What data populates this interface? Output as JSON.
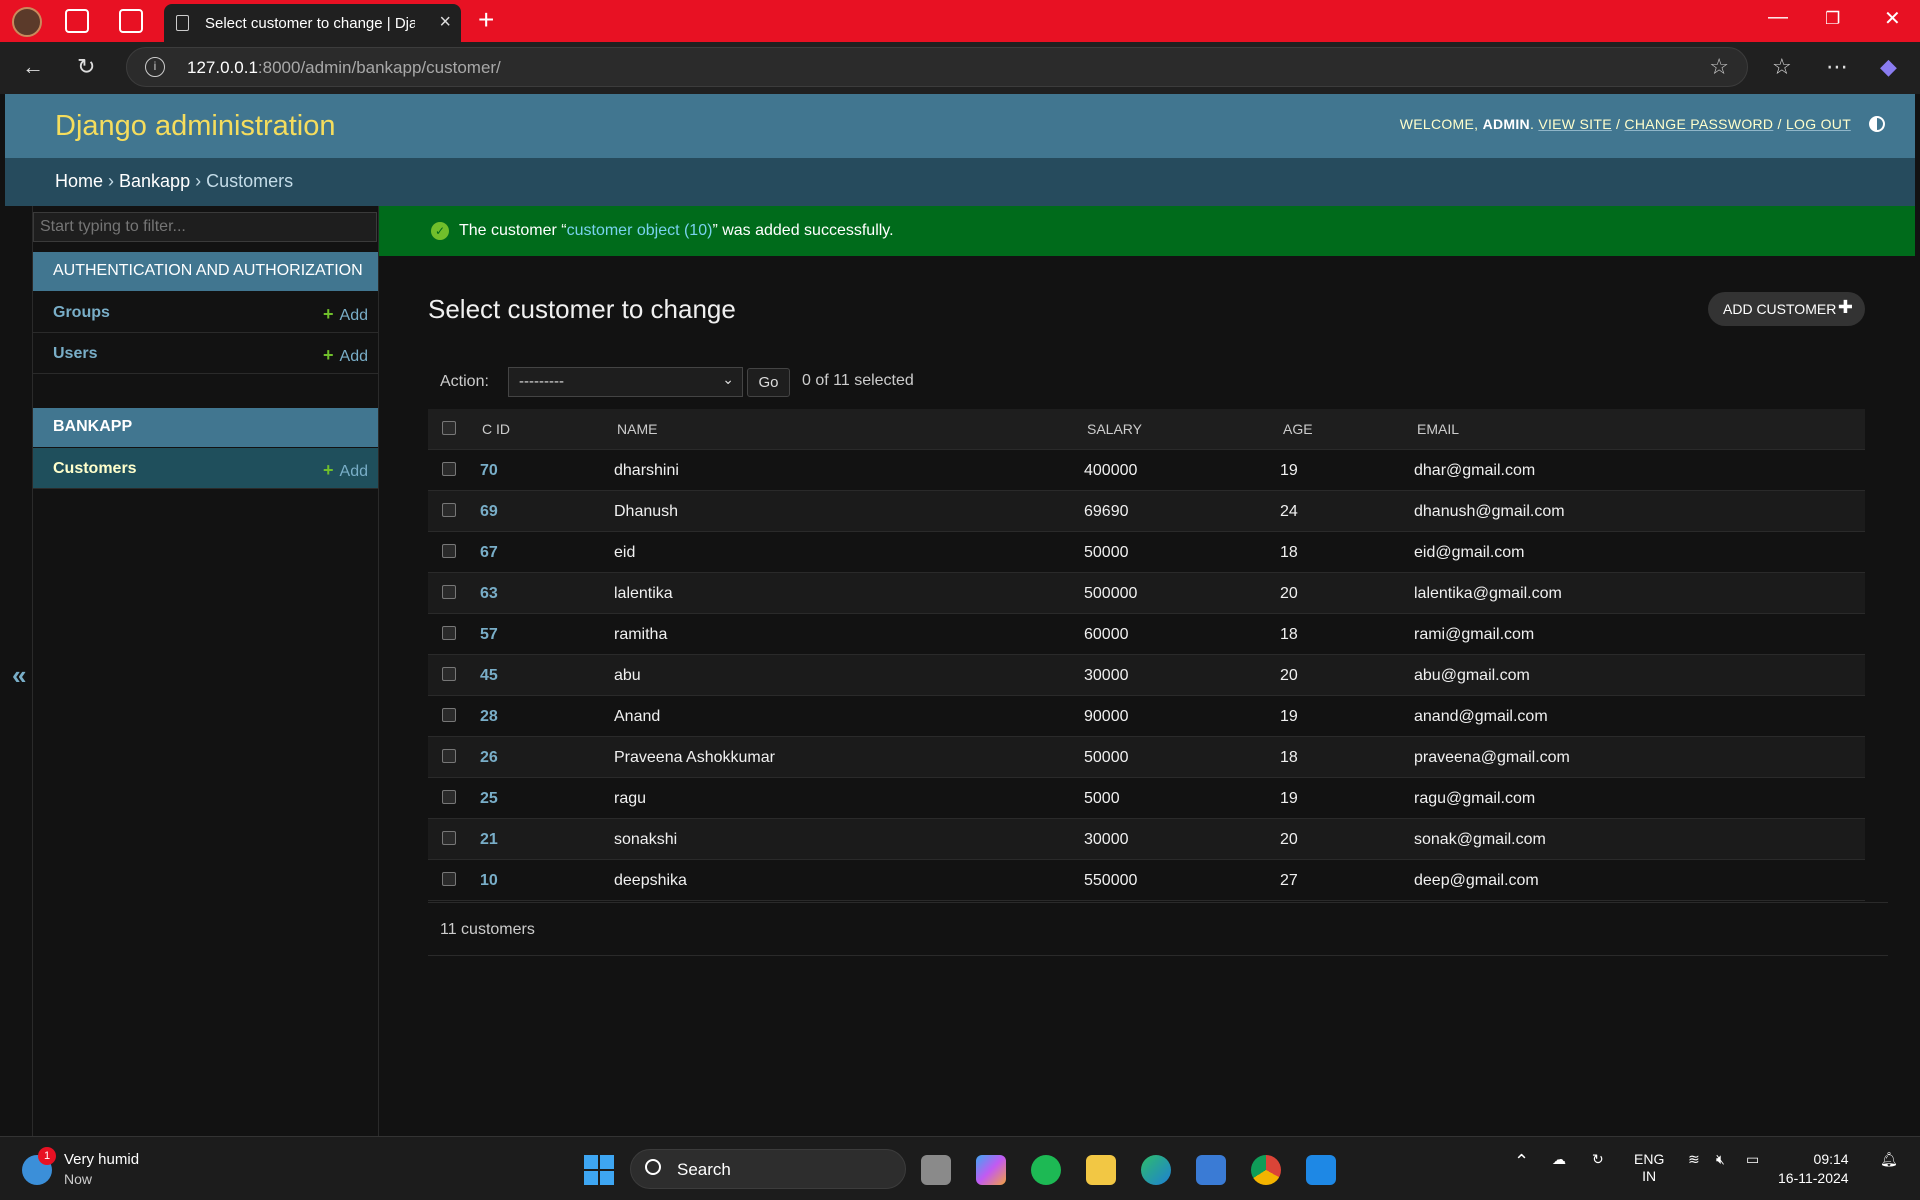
{
  "browser": {
    "tab_title": "Select customer to change | Django site admin",
    "url_host": "127.0.0.1",
    "url_path": ":8000/admin/bankapp/customer/"
  },
  "header": {
    "branding": "Django administration",
    "welcome": "WELCOME,",
    "username": "ADMIN",
    "view_site": "VIEW SITE",
    "change_password": "CHANGE PASSWORD",
    "log_out": "LOG OUT"
  },
  "breadcrumbs": {
    "home": "Home",
    "app": "Bankapp",
    "model": "Customers"
  },
  "sidebar": {
    "filter_placeholder": "Start typing to filter...",
    "modules": [
      {
        "caption": "Authentication and Authorization",
        "models": [
          {
            "name": "Groups",
            "add": "Add"
          },
          {
            "name": "Users",
            "add": "Add"
          }
        ]
      },
      {
        "caption": "Bankapp",
        "models": [
          {
            "name": "Customers",
            "add": "Add"
          }
        ]
      }
    ],
    "toggle_glyph": "«"
  },
  "message": {
    "prefix": "The customer “",
    "link": "customer object (10)",
    "suffix": "” was added successfully."
  },
  "main": {
    "title": "Select customer to change",
    "add_button": "ADD CUSTOMER",
    "action_label": "Action:",
    "action_selected": "---------",
    "go": "Go",
    "counter": "0 of 11 selected",
    "columns": [
      "C ID",
      "NAME",
      "SALARY",
      "AGE",
      "EMAIL"
    ],
    "rows": [
      {
        "cid": "70",
        "name": "dharshini",
        "salary": "400000",
        "age": "19",
        "email": "dhar@gmail.com"
      },
      {
        "cid": "69",
        "name": "Dhanush",
        "salary": "69690",
        "age": "24",
        "email": "dhanush@gmail.com"
      },
      {
        "cid": "67",
        "name": "eid",
        "salary": "50000",
        "age": "18",
        "email": "eid@gmail.com"
      },
      {
        "cid": "63",
        "name": "lalentika",
        "salary": "500000",
        "age": "20",
        "email": "lalentika@gmail.com"
      },
      {
        "cid": "57",
        "name": "ramitha",
        "salary": "60000",
        "age": "18",
        "email": "rami@gmail.com"
      },
      {
        "cid": "45",
        "name": "abu",
        "salary": "30000",
        "age": "20",
        "email": "abu@gmail.com"
      },
      {
        "cid": "28",
        "name": "Anand",
        "salary": "90000",
        "age": "19",
        "email": "anand@gmail.com"
      },
      {
        "cid": "26",
        "name": "Praveena Ashokkumar",
        "salary": "50000",
        "age": "18",
        "email": "praveena@gmail.com"
      },
      {
        "cid": "25",
        "name": "ragu",
        "salary": "5000",
        "age": "19",
        "email": "ragu@gmail.com"
      },
      {
        "cid": "21",
        "name": "sonakshi",
        "salary": "30000",
        "age": "20",
        "email": "sonak@gmail.com"
      },
      {
        "cid": "10",
        "name": "deepshika",
        "salary": "550000",
        "age": "27",
        "email": "deep@gmail.com"
      }
    ],
    "paginator": "11 customers"
  },
  "taskbar": {
    "weather_title": "Very humid",
    "weather_sub": "Now",
    "weather_badge": "1",
    "search": "Search",
    "lang_1": "ENG",
    "lang_2": "IN",
    "time": "09:14",
    "date": "16-11-2024"
  },
  "colors": {
    "header_bg": "#417690",
    "branding": "#f5dd5d",
    "success_bg": "#006b1b",
    "link": "#79aec8",
    "browser_frame": "#e81123"
  }
}
